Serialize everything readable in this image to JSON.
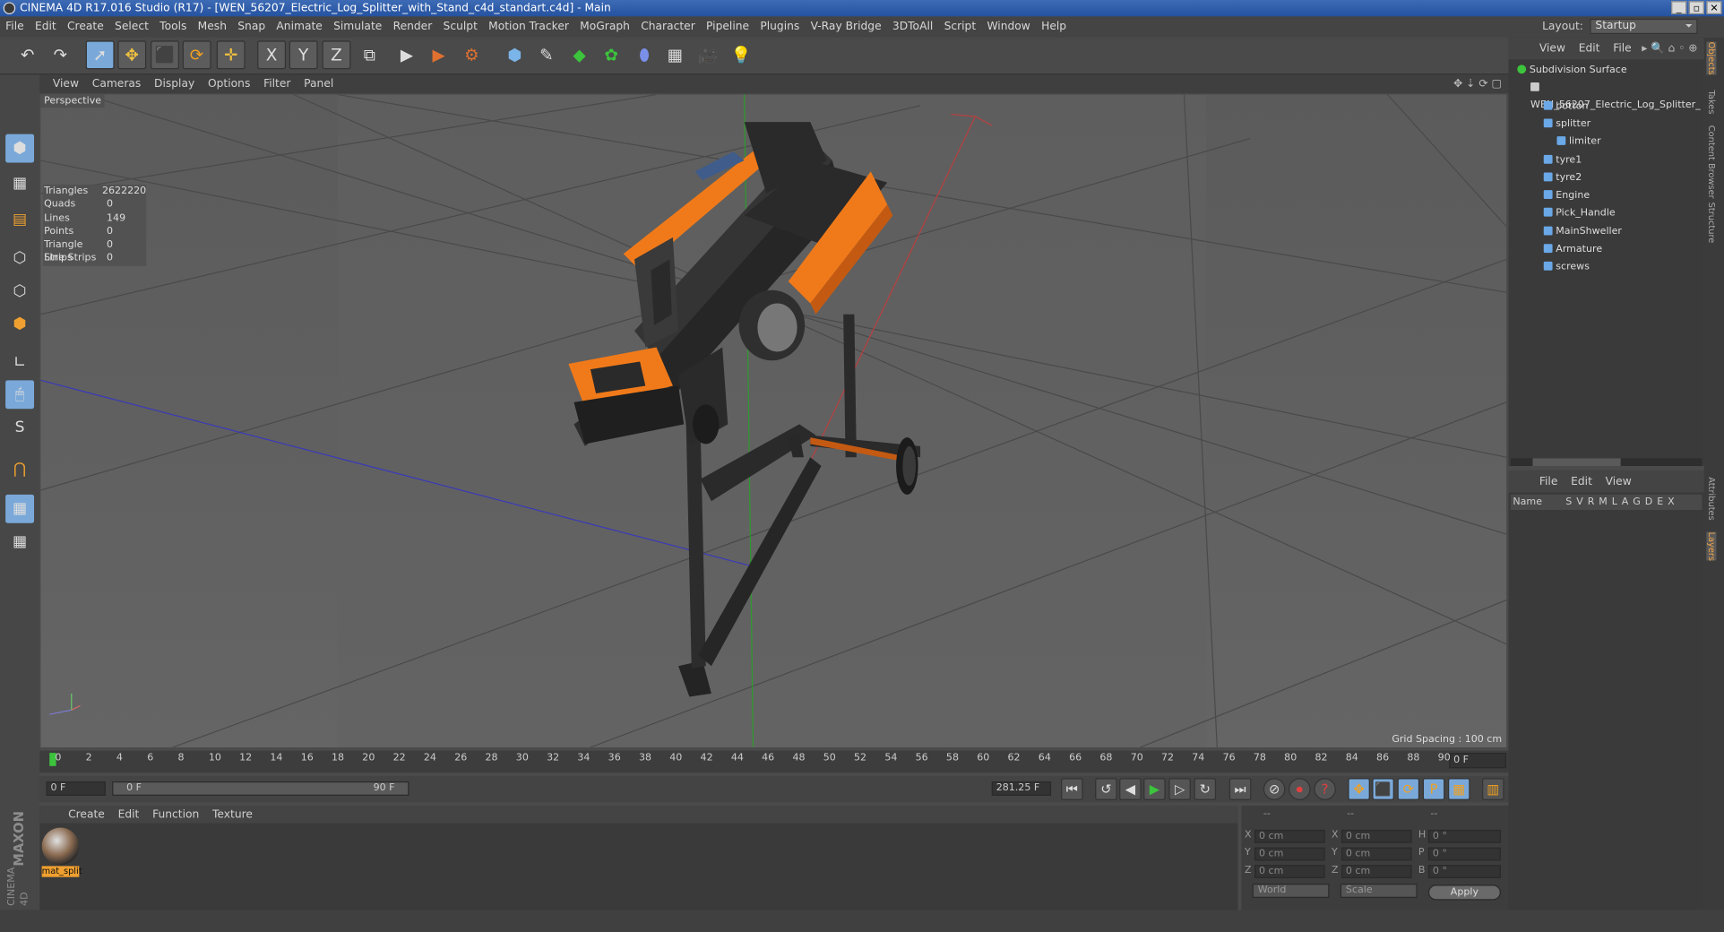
{
  "window": {
    "title": "CINEMA 4D R17.016 Studio (R17) - [WEN_56207_Electric_Log_Splitter_with_Stand_c4d_standart.c4d] - Main",
    "buttons": [
      "_",
      "▫",
      "✕"
    ]
  },
  "menu": [
    "File",
    "Edit",
    "Create",
    "Select",
    "Tools",
    "Mesh",
    "Snap",
    "Animate",
    "Simulate",
    "Render",
    "Sculpt",
    "Motion Tracker",
    "MoGraph",
    "Character",
    "Pipeline",
    "Plugins",
    "V-Ray Bridge",
    "3DToAll",
    "Script",
    "Window",
    "Help"
  ],
  "layout": {
    "label": "Layout:",
    "value": "Startup"
  },
  "toolbar_icons": [
    "undo-icon",
    "redo-icon",
    "select-icon",
    "move-icon",
    "scale-icon",
    "rotate-icon",
    "transform-icon",
    "x-axis-icon",
    "y-axis-icon",
    "z-axis-icon",
    "coordinate-system-icon",
    "render-view-icon",
    "render-picture-viewer-icon",
    "render-settings-icon",
    "cube-icon",
    "pen-icon",
    "subdivision-icon",
    "cloner-icon",
    "deformer-icon",
    "floor-icon",
    "camera-icon",
    "light-icon"
  ],
  "toolbar_glyphs": {
    "undo": "↶",
    "redo": "↷",
    "select": "➚",
    "move": "✥",
    "scale": "⬛",
    "rotate": "⟳",
    "transform": "✛",
    "x": "X",
    "y": "Y",
    "z": "Z",
    "coord": "⧉",
    "r1": "▶",
    "r2": "▶",
    "r3": "⚙",
    "cube": "⬢",
    "pen": "✎",
    "sub": "◆",
    "clone": "✿",
    "deform": "⬮",
    "floor": "▦",
    "cam": "🎥",
    "light": "💡"
  },
  "left_tools": [
    "model-mode-icon",
    "texture-mode-icon",
    "workplane-icon",
    "points-mode-icon",
    "edges-mode-icon",
    "polygons-mode-icon",
    "axis-icon",
    "tweak-icon",
    "soft-selection-icon",
    "snap-icon",
    "workplane-lock-icon",
    "grid-snap-icon"
  ],
  "left_glyphs": [
    "⬢",
    "▦",
    "▤",
    "⬡",
    "⬡",
    "⬢",
    "∟",
    "🖱",
    "S",
    "⋂",
    "▦",
    "▦"
  ],
  "viewport": {
    "menu": [
      "View",
      "Cameras",
      "Display",
      "Options",
      "Filter",
      "Panel"
    ],
    "label": "Perspective",
    "stats": [
      {
        "k": "Triangles",
        "v": "2622220"
      },
      {
        "k": "Quads",
        "v": "0"
      },
      {
        "k": "Lines",
        "v": "149"
      },
      {
        "k": "Points",
        "v": "0"
      },
      {
        "k": "Triangle Strips",
        "v": "0"
      },
      {
        "k": "Line Strips",
        "v": "0"
      }
    ],
    "grid_spacing": "Grid Spacing : 100 cm",
    "nav_icons": "✥ ⇣ ⟳ ▢"
  },
  "timeline": {
    "ticks": [
      "0",
      "2",
      "4",
      "6",
      "8",
      "10",
      "12",
      "14",
      "16",
      "18",
      "20",
      "22",
      "24",
      "26",
      "28",
      "30",
      "32",
      "34",
      "36",
      "38",
      "40",
      "42",
      "44",
      "46",
      "48",
      "50",
      "52",
      "54",
      "56",
      "58",
      "60",
      "62",
      "64",
      "66",
      "68",
      "70",
      "72",
      "74",
      "76",
      "78",
      "80",
      "82",
      "84",
      "86",
      "88",
      "90"
    ],
    "current_frame": "0 F"
  },
  "transport": {
    "start": "0 F",
    "range_start": "0 F",
    "range_end": "90 F",
    "fps_field": "281.25 F",
    "buttons": [
      "⏮",
      "↺",
      "◀",
      "▶",
      "▷",
      "↻",
      "⏭"
    ],
    "key_buttons": [
      "⊘",
      "⏺",
      "?"
    ],
    "mode_buttons": [
      "✥",
      "⬛",
      "⟳",
      "P",
      "▦",
      "▥"
    ]
  },
  "material": {
    "menu": [
      "Create",
      "Edit",
      "Function",
      "Texture"
    ],
    "items": [
      {
        "name": "mat_split"
      }
    ]
  },
  "coords": {
    "headers": [
      "--",
      "--",
      "--"
    ],
    "rows": [
      {
        "a": "X",
        "av": "0 cm",
        "b": "X",
        "bv": "0 cm",
        "c": "H",
        "cv": "0 °"
      },
      {
        "a": "Y",
        "av": "0 cm",
        "b": "Y",
        "bv": "0 cm",
        "c": "P",
        "cv": "0 °"
      },
      {
        "a": "Z",
        "av": "0 cm",
        "b": "Z",
        "bv": "0 cm",
        "c": "B",
        "cv": "0 °"
      }
    ],
    "world": "World",
    "scale": "Scale",
    "apply": "Apply"
  },
  "objects": {
    "menu": [
      "File",
      "Edit",
      "View"
    ],
    "tree": [
      {
        "name": "Subdivision Surface",
        "level": 0,
        "color": "#3cc43c"
      },
      {
        "name": "WEN_56207_Electric_Log_Splitter_",
        "level": 1,
        "color": "#cccccc"
      },
      {
        "name": "botton",
        "level": 2,
        "color": "#6aa8e8"
      },
      {
        "name": "splitter",
        "level": 2,
        "color": "#6aa8e8"
      },
      {
        "name": "limiter",
        "level": 3,
        "color": "#6aa8e8"
      },
      {
        "name": "tyre1",
        "level": 2,
        "color": "#6aa8e8"
      },
      {
        "name": "tyre2",
        "level": 2,
        "color": "#6aa8e8"
      },
      {
        "name": "Engine",
        "level": 2,
        "color": "#6aa8e8"
      },
      {
        "name": "Pick_Handle",
        "level": 2,
        "color": "#6aa8e8"
      },
      {
        "name": "MainShweller",
        "level": 2,
        "color": "#6aa8e8"
      },
      {
        "name": "Armature",
        "level": 2,
        "color": "#6aa8e8"
      },
      {
        "name": "screws",
        "level": 2,
        "color": "#6aa8e8"
      }
    ]
  },
  "layers": {
    "menu": [
      "File",
      "Edit",
      "View"
    ],
    "columns": [
      "Name",
      "S",
      "V",
      "R",
      "M",
      "L",
      "A",
      "G",
      "D",
      "E",
      "X"
    ]
  },
  "side_tabs": [
    "Objects",
    "Takes",
    "Content Browser",
    "Structure",
    "Attributes",
    "Layers"
  ],
  "brand": {
    "line1": "MAXON",
    "line2": "CINEMA 4D"
  },
  "colors": {
    "accent": "#f07a1a",
    "active_tool": "#7aa9d9"
  }
}
